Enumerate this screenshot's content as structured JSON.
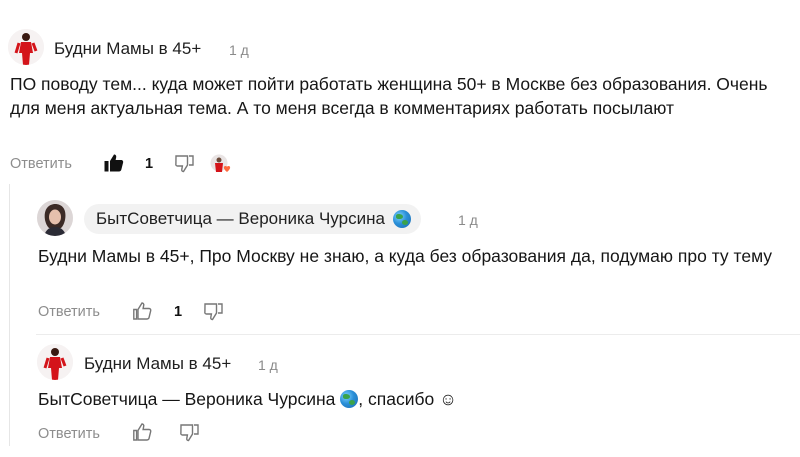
{
  "comments": [
    {
      "author": "Будни Мамы в 45+",
      "time": "1 д",
      "text": "ПО поводу тем... куда может пойти работать женщина 50+ в Москве без образования. Очень для меня актуальная тема. А то меня всегда в комментариях работать посылают",
      "reply_label": "Ответить",
      "likes": "1"
    },
    {
      "author": "БытСоветчица — Вероника Чурсина",
      "time": "1 д",
      "text": "Будни Мамы в 45+, Про Москву не знаю, а куда без образования да, подумаю про ту тему",
      "reply_label": "Ответить",
      "likes": "1"
    },
    {
      "author": "Будни Мамы в 45+",
      "time": "1 д",
      "text_mention": "БытСоветчица — Вероника Чурсина",
      "text_rest": ", спасибо ☺",
      "reply_label": "Ответить"
    }
  ],
  "icons": {
    "like": "thumbs-up-icon",
    "dislike": "thumbs-down-icon",
    "globe": "globe-emoji-icon",
    "author_liked": "author-heart-avatar-icon"
  },
  "colors": {
    "muted": "#8d8d8d",
    "avatar_red": "#d4141a",
    "heart": "#ff6a3d"
  }
}
